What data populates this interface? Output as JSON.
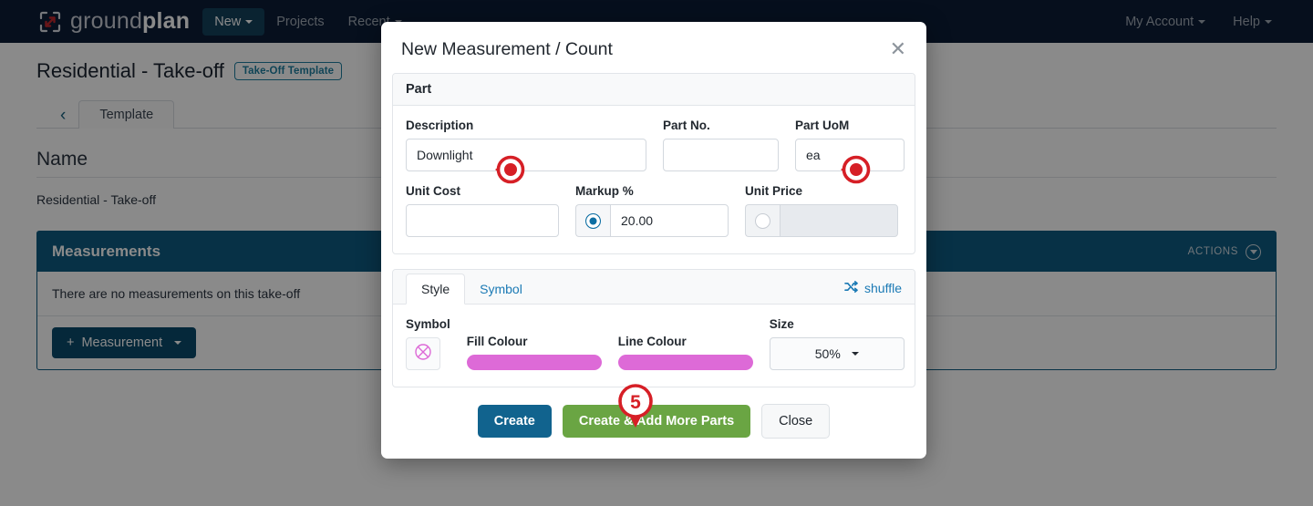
{
  "navbar": {
    "brand_text_light": "ground",
    "brand_text_bold": "plan",
    "logo_icon": "expand-arrows-icon",
    "items": [
      {
        "label": "New",
        "active": true,
        "has_caret": true
      },
      {
        "label": "Projects",
        "active": false,
        "has_caret": false
      },
      {
        "label": "Recent",
        "active": false,
        "has_caret": true
      }
    ],
    "right_items": [
      {
        "label": "My Account",
        "has_caret": true
      },
      {
        "label": "Help",
        "has_caret": true
      }
    ]
  },
  "page": {
    "title": "Residential - Take-off",
    "title_badge": "Take-Off Template",
    "back_icon": "chevron-left-icon",
    "tab": "Template",
    "name_section_label": "Name",
    "name_value": "Residential - Take-off",
    "measurements_panel": {
      "title": "Measurements",
      "actions_label": "ACTIONS",
      "actions_icon": "chevron-down-circle-icon",
      "empty_text": "There are no measurements on this take-off",
      "add_button": "Measurement",
      "add_icon": "plus-icon",
      "add_caret_icon": "caret-down-icon"
    }
  },
  "modal": {
    "title": "New Measurement / Count",
    "close_icon": "close-icon",
    "part_section": {
      "header": "Part",
      "description_label": "Description",
      "description_value": "Downlight",
      "part_no_label": "Part No.",
      "part_no_value": "",
      "part_uom_label": "Part UoM",
      "part_uom_value": "ea",
      "unit_cost_label": "Unit Cost",
      "unit_cost_value": "",
      "markup_label": "Markup %",
      "markup_value": "20.00",
      "markup_selected": true,
      "unit_price_label": "Unit Price",
      "unit_price_value": "",
      "unit_price_selected": false
    },
    "style_section": {
      "tab_style": "Style",
      "tab_symbol": "Symbol",
      "shuffle_label": "shuffle",
      "shuffle_icon": "shuffle-icon",
      "symbol_label": "Symbol",
      "symbol_icon": "circle-x-icon",
      "fill_colour_label": "Fill Colour",
      "fill_colour": "#dd6ad7",
      "line_colour_label": "Line Colour",
      "line_colour": "#dd6ad7",
      "size_label": "Size",
      "size_value": "50%",
      "size_caret_icon": "caret-down-icon"
    },
    "footer": {
      "create": "Create",
      "create_more": "Create & Add More Parts",
      "close": "Close"
    }
  },
  "annotations": {
    "marker_number": "5",
    "marker_color": "#d61f26",
    "cursor_icon": "cursor-dot-icon"
  },
  "colors": {
    "navbar_bg": "#0c1c36",
    "panel_blue": "#0d5c82",
    "accent_teal": "#1f7fa0",
    "create_blue": "#11638e",
    "green": "#6aa543",
    "magenta": "#dd6ad7"
  }
}
